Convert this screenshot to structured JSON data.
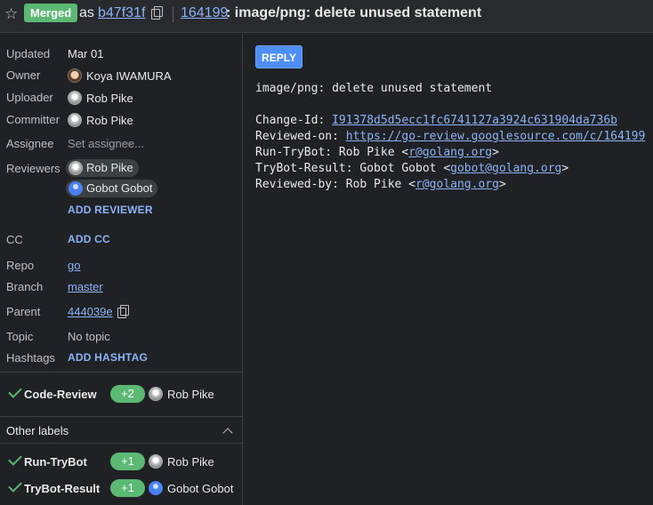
{
  "header": {
    "status_badge": "Merged",
    "as_text": "as",
    "commit_short": "b47f31f",
    "change_number": "164199",
    "change_title": ": image/png: delete unused statement"
  },
  "sidebar": {
    "updated_label": "Updated",
    "updated_value": "Mar 01",
    "owner_label": "Owner",
    "owner_value": "Koya IWAMURA",
    "uploader_label": "Uploader",
    "uploader_value": "Rob Pike",
    "committer_label": "Committer",
    "committer_value": "Rob Pike",
    "assignee_label": "Assignee",
    "assignee_placeholder": "Set assignee...",
    "reviewers_label": "Reviewers",
    "reviewers": [
      "Rob Pike",
      "Gobot Gobot"
    ],
    "add_reviewer": "ADD REVIEWER",
    "cc_label": "CC",
    "add_cc": "ADD CC",
    "repo_label": "Repo",
    "repo_value": "go",
    "branch_label": "Branch",
    "branch_value": "master",
    "parent_label": "Parent",
    "parent_value": "444039e",
    "topic_label": "Topic",
    "topic_value": "No topic",
    "hashtags_label": "Hashtags",
    "add_hashtag": "ADD HASHTAG"
  },
  "labels": {
    "code_review": {
      "name": "Code-Review",
      "vote": "+2",
      "user": "Rob Pike"
    },
    "other_labels_title": "Other labels",
    "run_trybot": {
      "name": "Run-TryBot",
      "vote": "+1",
      "user": "Rob Pike"
    },
    "trybot_result": {
      "name": "TryBot-Result",
      "vote": "+1",
      "user": "Gobot Gobot"
    }
  },
  "main": {
    "reply_button": "REPLY",
    "subject": "image/png: delete unused statement",
    "change_id_label": "Change-Id: ",
    "change_id": "I91378d5d5ecc1fc6741127a3924c631904da736b",
    "reviewed_on_label": "Reviewed-on: ",
    "reviewed_on": "https://go-review.googlesource.com/c/164199",
    "run_trybot_label": "Run-TryBot: Rob Pike <",
    "run_trybot_email": "r@golang.org",
    "trybot_result_label": "TryBot-Result: Gobot Gobot <",
    "trybot_result_email": "gobot@golang.org",
    "reviewed_by_label": "Reviewed-by: Rob Pike <",
    "reviewed_by_email": "r@golang.org",
    "close_angle": ">"
  },
  "colors": {
    "accent": "#8ab4f8",
    "approved": "#5bb974",
    "background": "#202124"
  }
}
